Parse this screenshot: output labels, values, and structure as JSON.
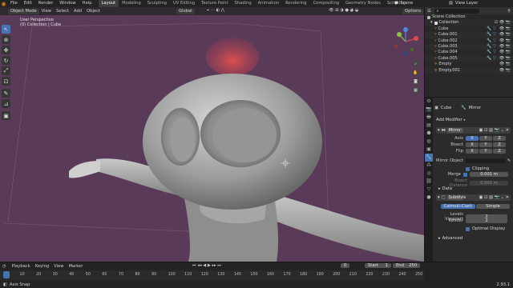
{
  "menu": [
    "File",
    "Edit",
    "Render",
    "Window",
    "Help"
  ],
  "workspaces": [
    "Layout",
    "Modeling",
    "Sculpting",
    "UV Editing",
    "Texture Paint",
    "Shading",
    "Animation",
    "Rendering",
    "Compositing",
    "Geometry Nodes",
    "Scripting"
  ],
  "scene": {
    "label": "Scene",
    "view_layer": "View Layer"
  },
  "viewport": {
    "mode": "Object Mode",
    "header_menus": [
      "View",
      "Select",
      "Add",
      "Object"
    ],
    "orientation": "Global",
    "options": "Options",
    "info_line1": "User Perspective",
    "info_line2": "(0) Collection | Cube"
  },
  "outliner": {
    "root": "Scene Collection",
    "collection": "Collection",
    "items": [
      "Cube",
      "Cube.001",
      "Cube.002",
      "Cube.003",
      "Cube.004",
      "Cube.005",
      "Empty",
      "Empty.001"
    ]
  },
  "properties": {
    "object": "Cube",
    "modifier_tab": "Mirror",
    "add_modifier": "Add Modifier",
    "mirror": {
      "name": "Mirror",
      "axis_label": "Axis",
      "bisect_label": "Bisect",
      "flip_label": "Flip",
      "axes": [
        "X",
        "Y",
        "Z"
      ],
      "mirror_object_label": "Mirror Object",
      "clipping": "Clipping",
      "merge_label": "Merge",
      "merge_value": "0.001 m",
      "bisect_distance_label": "Bisect Distance",
      "bisect_distance_value": "0.001 m",
      "data": "Data"
    },
    "subsurf": {
      "name": "Subdivis",
      "catmull": "Catmull-Clark",
      "simple": "Simple",
      "levels_label": "Levels Viewport",
      "levels_value": "2",
      "render_label": "Render",
      "render_value": "2",
      "optimal": "Optimal Display",
      "advanced": "Advanced"
    }
  },
  "timeline": {
    "menus": [
      "Playback",
      "Keying",
      "View",
      "Marker"
    ],
    "current_frame": "0",
    "start_label": "Start",
    "start": "1",
    "end_label": "End",
    "end": "250",
    "ticks": [
      "0",
      "10",
      "20",
      "30",
      "40",
      "50",
      "60",
      "70",
      "80",
      "90",
      "100",
      "110",
      "120",
      "130",
      "140",
      "150",
      "160",
      "170",
      "180",
      "190",
      "200",
      "210",
      "220",
      "230",
      "240",
      "250"
    ]
  },
  "status": {
    "left": "Axis Snap",
    "version": "2.93.1"
  },
  "colors": {
    "accent": "#4772b3",
    "background": "#5a3a59",
    "active_frame": "#4772b3"
  }
}
